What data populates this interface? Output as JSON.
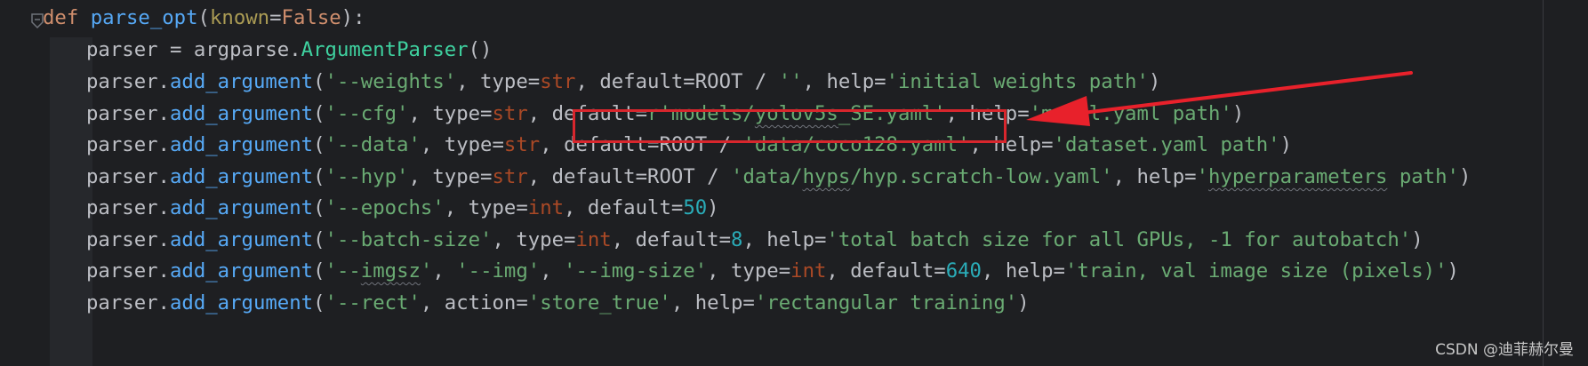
{
  "code_lines": [
    {
      "kind": "def",
      "keyword": "def",
      "name": "parse_opt",
      "paren_open": "(",
      "param": "known",
      "eq": "=",
      "default": "False",
      "tail": "):"
    },
    {
      "kind": "assign",
      "var": "parser",
      "op": " = ",
      "module": "argparse",
      "dot": ".",
      "cls": "ArgumentParser",
      "call": "()"
    },
    {
      "kind": "arg",
      "parts": [
        {
          "t": "parser",
          "c": "var"
        },
        {
          "t": ".",
          "c": "op"
        },
        {
          "t": "add_argument",
          "c": "attr"
        },
        {
          "t": "(",
          "c": "op"
        },
        {
          "t": "'--weights'",
          "c": "str"
        },
        {
          "t": ", ",
          "c": "op"
        },
        {
          "t": "type",
          "c": "op"
        },
        {
          "t": "=",
          "c": "op"
        },
        {
          "t": "str",
          "c": "kwarg"
        },
        {
          "t": ", ",
          "c": "op"
        },
        {
          "t": "default",
          "c": "op"
        },
        {
          "t": "=",
          "c": "op"
        },
        {
          "t": "ROOT",
          "c": "var"
        },
        {
          "t": " / ",
          "c": "op"
        },
        {
          "t": "''",
          "c": "str"
        },
        {
          "t": ", ",
          "c": "op"
        },
        {
          "t": "help",
          "c": "op"
        },
        {
          "t": "=",
          "c": "op"
        },
        {
          "t": "'initial weights path'",
          "c": "str"
        },
        {
          "t": ")",
          "c": "op"
        }
      ]
    },
    {
      "kind": "arg",
      "parts": [
        {
          "t": "parser",
          "c": "var"
        },
        {
          "t": ".",
          "c": "op"
        },
        {
          "t": "add_argument",
          "c": "attr"
        },
        {
          "t": "(",
          "c": "op"
        },
        {
          "t": "'--cfg'",
          "c": "str"
        },
        {
          "t": ", ",
          "c": "op"
        },
        {
          "t": "type",
          "c": "op"
        },
        {
          "t": "=",
          "c": "op"
        },
        {
          "t": "str",
          "c": "kwarg"
        },
        {
          "t": ", ",
          "c": "op"
        },
        {
          "t": "default",
          "c": "op"
        },
        {
          "t": "=",
          "c": "op"
        },
        {
          "t": "r'models/",
          "c": "str"
        },
        {
          "t": "yolov5s",
          "c": "str",
          "squig": true
        },
        {
          "t": "_SE.yaml'",
          "c": "str"
        },
        {
          "t": ", ",
          "c": "op"
        },
        {
          "t": "help",
          "c": "op"
        },
        {
          "t": "=",
          "c": "op"
        },
        {
          "t": "'model.yaml path'",
          "c": "str"
        },
        {
          "t": ")",
          "c": "op"
        }
      ]
    },
    {
      "kind": "arg",
      "parts": [
        {
          "t": "parser",
          "c": "var"
        },
        {
          "t": ".",
          "c": "op"
        },
        {
          "t": "add_argument",
          "c": "attr"
        },
        {
          "t": "(",
          "c": "op"
        },
        {
          "t": "'--data'",
          "c": "str"
        },
        {
          "t": ", ",
          "c": "op"
        },
        {
          "t": "type",
          "c": "op"
        },
        {
          "t": "=",
          "c": "op"
        },
        {
          "t": "str",
          "c": "kwarg"
        },
        {
          "t": ", ",
          "c": "op"
        },
        {
          "t": "default",
          "c": "op"
        },
        {
          "t": "=",
          "c": "op"
        },
        {
          "t": "ROOT",
          "c": "var"
        },
        {
          "t": " / ",
          "c": "op"
        },
        {
          "t": "'data/coco128.yaml'",
          "c": "str"
        },
        {
          "t": ", ",
          "c": "op"
        },
        {
          "t": "help",
          "c": "op"
        },
        {
          "t": "=",
          "c": "op"
        },
        {
          "t": "'dataset.yaml path'",
          "c": "str"
        },
        {
          "t": ")",
          "c": "op"
        }
      ]
    },
    {
      "kind": "arg",
      "parts": [
        {
          "t": "parser",
          "c": "var"
        },
        {
          "t": ".",
          "c": "op"
        },
        {
          "t": "add_argument",
          "c": "attr"
        },
        {
          "t": "(",
          "c": "op"
        },
        {
          "t": "'--hyp'",
          "c": "str"
        },
        {
          "t": ", ",
          "c": "op"
        },
        {
          "t": "type",
          "c": "op"
        },
        {
          "t": "=",
          "c": "op"
        },
        {
          "t": "str",
          "c": "kwarg"
        },
        {
          "t": ", ",
          "c": "op"
        },
        {
          "t": "default",
          "c": "op"
        },
        {
          "t": "=",
          "c": "op"
        },
        {
          "t": "ROOT",
          "c": "var"
        },
        {
          "t": " / ",
          "c": "op"
        },
        {
          "t": "'data/",
          "c": "str"
        },
        {
          "t": "hyps",
          "c": "str",
          "squig": true
        },
        {
          "t": "/hyp.scratch-low.yaml'",
          "c": "str"
        },
        {
          "t": ", ",
          "c": "op"
        },
        {
          "t": "help",
          "c": "op"
        },
        {
          "t": "=",
          "c": "op"
        },
        {
          "t": "'",
          "c": "str"
        },
        {
          "t": "hyperparameters",
          "c": "str",
          "squig": true
        },
        {
          "t": " path'",
          "c": "str"
        },
        {
          "t": ")",
          "c": "op"
        }
      ]
    },
    {
      "kind": "arg",
      "parts": [
        {
          "t": "parser",
          "c": "var"
        },
        {
          "t": ".",
          "c": "op"
        },
        {
          "t": "add_argument",
          "c": "attr"
        },
        {
          "t": "(",
          "c": "op"
        },
        {
          "t": "'--epochs'",
          "c": "str"
        },
        {
          "t": ", ",
          "c": "op"
        },
        {
          "t": "type",
          "c": "op"
        },
        {
          "t": "=",
          "c": "op"
        },
        {
          "t": "int",
          "c": "kwarg"
        },
        {
          "t": ", ",
          "c": "op"
        },
        {
          "t": "default",
          "c": "op"
        },
        {
          "t": "=",
          "c": "op"
        },
        {
          "t": "50",
          "c": "num"
        },
        {
          "t": ")",
          "c": "op"
        }
      ]
    },
    {
      "kind": "arg",
      "parts": [
        {
          "t": "parser",
          "c": "var"
        },
        {
          "t": ".",
          "c": "op"
        },
        {
          "t": "add_argument",
          "c": "attr"
        },
        {
          "t": "(",
          "c": "op"
        },
        {
          "t": "'--batch-size'",
          "c": "str"
        },
        {
          "t": ", ",
          "c": "op"
        },
        {
          "t": "type",
          "c": "op"
        },
        {
          "t": "=",
          "c": "op"
        },
        {
          "t": "int",
          "c": "kwarg"
        },
        {
          "t": ", ",
          "c": "op"
        },
        {
          "t": "default",
          "c": "op"
        },
        {
          "t": "=",
          "c": "op"
        },
        {
          "t": "8",
          "c": "num"
        },
        {
          "t": ", ",
          "c": "op"
        },
        {
          "t": "help",
          "c": "op"
        },
        {
          "t": "=",
          "c": "op"
        },
        {
          "t": "'total batch size for all GPUs, -1 for autobatch'",
          "c": "str"
        },
        {
          "t": ")",
          "c": "op"
        }
      ]
    },
    {
      "kind": "arg",
      "parts": [
        {
          "t": "parser",
          "c": "var"
        },
        {
          "t": ".",
          "c": "op"
        },
        {
          "t": "add_argument",
          "c": "attr"
        },
        {
          "t": "(",
          "c": "op"
        },
        {
          "t": "'--",
          "c": "str"
        },
        {
          "t": "imgsz",
          "c": "str",
          "squig": true
        },
        {
          "t": "'",
          "c": "str"
        },
        {
          "t": ", ",
          "c": "op"
        },
        {
          "t": "'--img'",
          "c": "str"
        },
        {
          "t": ", ",
          "c": "op"
        },
        {
          "t": "'--img-size'",
          "c": "str"
        },
        {
          "t": ", ",
          "c": "op"
        },
        {
          "t": "type",
          "c": "op"
        },
        {
          "t": "=",
          "c": "op"
        },
        {
          "t": "int",
          "c": "kwarg"
        },
        {
          "t": ", ",
          "c": "op"
        },
        {
          "t": "default",
          "c": "op"
        },
        {
          "t": "=",
          "c": "op"
        },
        {
          "t": "640",
          "c": "num"
        },
        {
          "t": ", ",
          "c": "op"
        },
        {
          "t": "help",
          "c": "op"
        },
        {
          "t": "=",
          "c": "op"
        },
        {
          "t": "'train, val image size (pixels)'",
          "c": "str"
        },
        {
          "t": ")",
          "c": "op"
        }
      ]
    },
    {
      "kind": "arg",
      "parts": [
        {
          "t": "parser",
          "c": "var"
        },
        {
          "t": ".",
          "c": "op"
        },
        {
          "t": "add_argument",
          "c": "attr"
        },
        {
          "t": "(",
          "c": "op"
        },
        {
          "t": "'--rect'",
          "c": "str"
        },
        {
          "t": ", ",
          "c": "op"
        },
        {
          "t": "action",
          "c": "op"
        },
        {
          "t": "=",
          "c": "op"
        },
        {
          "t": "'store_true'",
          "c": "str"
        },
        {
          "t": ", ",
          "c": "op"
        },
        {
          "t": "help",
          "c": "op"
        },
        {
          "t": "=",
          "c": "op"
        },
        {
          "t": "'rectangular training'",
          "c": "str"
        },
        {
          "t": ")",
          "c": "op"
        }
      ]
    }
  ],
  "annotation": {
    "box_color": "#d8262d",
    "arrow_color": "#e8212b"
  },
  "watermark": "CSDN @迪菲赫尔曼",
  "icons": {
    "fold": "fold-arrow-icon"
  }
}
